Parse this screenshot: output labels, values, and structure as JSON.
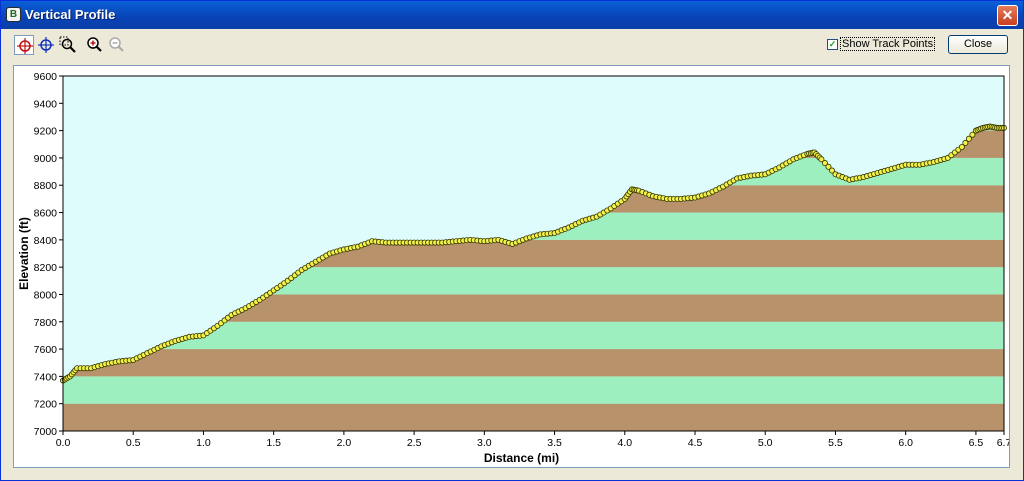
{
  "window": {
    "title": "Vertical Profile",
    "close_glyph": "✕",
    "app_icon": "trail-app-icon",
    "app_icon_glyph": "B"
  },
  "toolbar": {
    "tools": [
      {
        "name": "select-point-icon",
        "active": true
      },
      {
        "name": "pan-crosshair-icon",
        "active": false
      },
      {
        "name": "zoom-area-icon",
        "active": false
      },
      {
        "name": "zoom-in-icon",
        "active": false
      },
      {
        "name": "zoom-out-icon",
        "active": false,
        "disabled": true
      }
    ],
    "show_track_points_label": "Show Track Points",
    "show_track_points_checked": true,
    "close_label": "Close"
  },
  "colors": {
    "sky": "#dffcfc",
    "band_brown": "#b8926a",
    "band_green": "#9eefc0",
    "point_fill": "#f2f24a",
    "point_stroke": "#333300",
    "line": "#3a7fb0"
  },
  "chart_data": {
    "type": "area",
    "title": "",
    "xlabel": "Distance   (mi)",
    "ylabel": "Elevation (ft)",
    "xlim": [
      0,
      6.7
    ],
    "ylim": [
      7000,
      9600
    ],
    "x_ticks": [
      "0.0",
      "0.5",
      "1.0",
      "1.5",
      "2.0",
      "2.5",
      "3.0",
      "3.5",
      "4.0",
      "4.5",
      "5.0",
      "5.5",
      "6.0",
      "6.5",
      "6.7"
    ],
    "x_tick_values": [
      0,
      0.5,
      1,
      1.5,
      2,
      2.5,
      3,
      3.5,
      4,
      4.5,
      5,
      5.5,
      6,
      6.5,
      6.7
    ],
    "y_ticks": [
      "7000",
      "7200",
      "7400",
      "7600",
      "7800",
      "8000",
      "8200",
      "8400",
      "8600",
      "8800",
      "9000",
      "9200",
      "9400",
      "9600"
    ],
    "y_tick_values": [
      7000,
      7200,
      7400,
      7600,
      7800,
      8000,
      8200,
      8400,
      8600,
      8800,
      9000,
      9200,
      9400,
      9600
    ],
    "band_step": 200,
    "grid": false,
    "series": [
      {
        "x": [
          0.0,
          0.05,
          0.1,
          0.2,
          0.3,
          0.4,
          0.5,
          0.6,
          0.7,
          0.8,
          0.9,
          1.0,
          1.1,
          1.2,
          1.3,
          1.4,
          1.5,
          1.6,
          1.7,
          1.8,
          1.9,
          2.0,
          2.1,
          2.2,
          2.3,
          2.4,
          2.5,
          2.6,
          2.7,
          2.8,
          2.9,
          3.0,
          3.1,
          3.2,
          3.3,
          3.4,
          3.5,
          3.6,
          3.7,
          3.8,
          3.9,
          4.0,
          4.05,
          4.1,
          4.2,
          4.3,
          4.4,
          4.5,
          4.6,
          4.7,
          4.8,
          4.9,
          5.0,
          5.1,
          5.2,
          5.3,
          5.35,
          5.4,
          5.5,
          5.6,
          5.7,
          5.8,
          5.9,
          6.0,
          6.1,
          6.2,
          6.3,
          6.4,
          6.5,
          6.55,
          6.6,
          6.65,
          6.7
        ],
        "elevation": [
          7370,
          7400,
          7460,
          7460,
          7490,
          7510,
          7520,
          7570,
          7620,
          7660,
          7690,
          7700,
          7770,
          7850,
          7900,
          7960,
          8030,
          8100,
          8180,
          8240,
          8300,
          8330,
          8350,
          8390,
          8380,
          8380,
          8380,
          8380,
          8380,
          8390,
          8400,
          8390,
          8400,
          8370,
          8410,
          8440,
          8450,
          8490,
          8540,
          8570,
          8630,
          8700,
          8770,
          8760,
          8720,
          8700,
          8700,
          8710,
          8740,
          8790,
          8850,
          8870,
          8880,
          8930,
          8990,
          9030,
          9040,
          8990,
          8880,
          8840,
          8860,
          8890,
          8920,
          8950,
          8950,
          8970,
          9000,
          9080,
          9200,
          9220,
          9230,
          9220,
          9220
        ]
      }
    ]
  }
}
